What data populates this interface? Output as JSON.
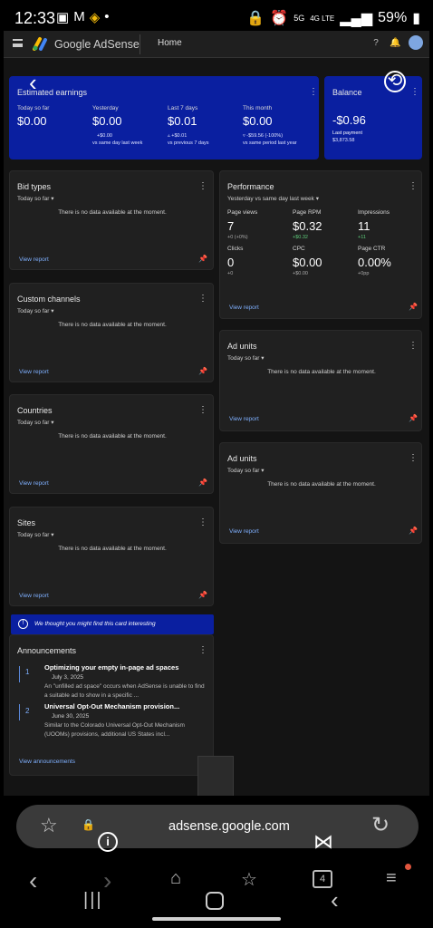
{
  "status_bar": {
    "time": "12:33",
    "battery": "59%",
    "signal": "4G LTE",
    "network_badge": "5G"
  },
  "app_header": {
    "brand": "Google AdSense",
    "page": "Home",
    "icons": [
      "menu-icon",
      "adsense-logo",
      "help-icon",
      "bell-icon",
      "avatar"
    ]
  },
  "estimated_earnings": {
    "title": "Estimated earnings",
    "items": [
      {
        "label": "Today so far",
        "value": "$0.00",
        "sub1": "",
        "sub2": ""
      },
      {
        "label": "Yesterday",
        "value": "$0.00",
        "sub1": "+$0.00",
        "sub2": "vs same day last week"
      },
      {
        "label": "Last 7 days",
        "value": "$0.01",
        "sub1": "▵ +$0.01",
        "sub2": "vs previous 7 days"
      },
      {
        "label": "This month",
        "value": "$0.00",
        "sub1": "▿ -$59.56 (-100%)",
        "sub2": "vs same period last year"
      }
    ]
  },
  "balance": {
    "title": "Balance",
    "value": "-$0.96",
    "last_payment_label": "Last payment",
    "last_payment_value": "$3,873.58"
  },
  "bid_types": {
    "title": "Bid types",
    "period": "Today so far",
    "nodata": "There is no data available at the moment.",
    "link": "View report"
  },
  "custom_channels": {
    "title": "Custom channels",
    "period": "Today so far",
    "nodata": "There is no data available at the moment.",
    "link": "View report"
  },
  "countries": {
    "title": "Countries",
    "period": "Today so far",
    "nodata": "There is no data available at the moment.",
    "link": "View report"
  },
  "sites": {
    "title": "Sites",
    "period": "Today so far",
    "nodata": "There is no data available at the moment.",
    "link": "View report"
  },
  "performance": {
    "title": "Performance",
    "period": "Yesterday vs same day last week",
    "metrics": [
      {
        "label": "Page views",
        "value": "7",
        "sub": "+0 (+0%)"
      },
      {
        "label": "Page RPM",
        "value": "$0.32",
        "sub": "+$0.32"
      },
      {
        "label": "Impressions",
        "value": "11",
        "sub": "+11"
      },
      {
        "label": "Clicks",
        "value": "0",
        "sub": "+0"
      },
      {
        "label": "CPC",
        "value": "$0.00",
        "sub": "+$0.00"
      },
      {
        "label": "Page CTR",
        "value": "0.00%",
        "sub": "+0pp"
      }
    ],
    "link": "View report"
  },
  "ad_units_1": {
    "title": "Ad units",
    "period": "Today so far",
    "nodata": "There is no data available at the moment.",
    "link": "View report"
  },
  "ad_units_2": {
    "title": "Ad units",
    "period": "Today so far",
    "nodata": "There is no data available at the moment.",
    "link": "View report"
  },
  "banner": {
    "text": "We thought you might find this card interesting"
  },
  "announcements": {
    "title": "Announcements",
    "items": [
      {
        "num": "1",
        "title": "Optimizing your empty in-page ad spaces",
        "date": "July 3, 2025",
        "desc": "An \"unfilled ad space\" occurs when AdSense is unable to find a suitable ad to show in a specific ..."
      },
      {
        "num": "2",
        "title": "Universal Opt-Out Mechanism provision...",
        "date": "June 30, 2025",
        "desc": "Similar to the Colorado Universal Opt-Out Mechanism (UOOMs) provisions, additional US States incl..."
      }
    ],
    "link": "View announcements"
  },
  "browser": {
    "url": "adsense.google.com",
    "tab_count": "4"
  },
  "colors": {
    "accent_blue": "#0a1fa0",
    "link_blue": "#7fb0ff",
    "positive_green": "#5ecb7a",
    "background": "#141414",
    "card": "#202020"
  }
}
